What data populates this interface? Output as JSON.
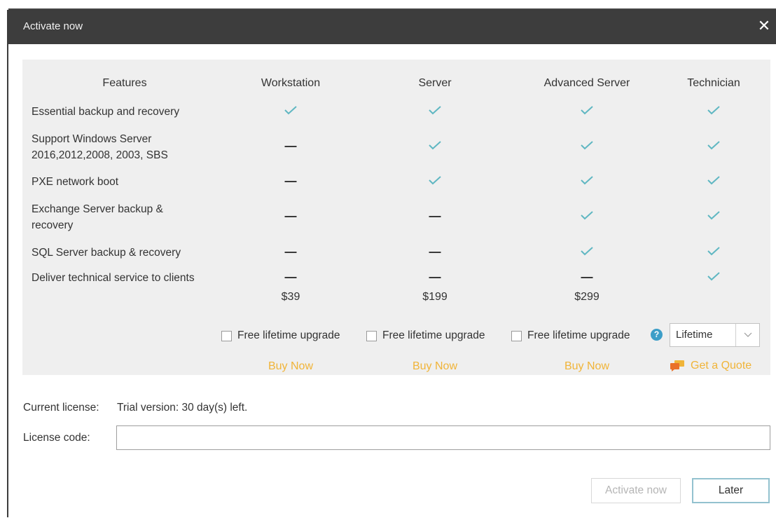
{
  "window": {
    "title": "Activate now",
    "close_label": "✕"
  },
  "colors": {
    "titlebar": "#3d3d3d",
    "panel": "#efefef",
    "check": "#5fb7c2",
    "accent_link": "#f0b438",
    "help": "#3c9ec8"
  },
  "table": {
    "headers": [
      "Features",
      "Workstation",
      "Server",
      "Advanced Server",
      "Technician"
    ],
    "features": [
      {
        "name": "Essential backup and recovery",
        "values": [
          true,
          true,
          true,
          true
        ]
      },
      {
        "name": "Support Windows Server 2016,2012,2008, 2003, SBS",
        "values": [
          false,
          true,
          true,
          true
        ]
      },
      {
        "name": "PXE network boot",
        "values": [
          false,
          true,
          true,
          true
        ]
      },
      {
        "name": "Exchange Server backup & recovery",
        "values": [
          false,
          false,
          true,
          true
        ]
      },
      {
        "name": "SQL Server backup & recovery",
        "values": [
          false,
          false,
          true,
          true
        ]
      },
      {
        "name": "Deliver technical service to clients",
        "values": [
          false,
          false,
          false,
          true
        ]
      }
    ],
    "prices": [
      "$39",
      "$199",
      "$299"
    ],
    "upgrade_label": "Free lifetime upgrade",
    "upgrade_checked": [
      false,
      false,
      false
    ],
    "license_type": {
      "selected": "Lifetime"
    },
    "buy_label": "Buy Now",
    "quote_label": "Get a Quote"
  },
  "license": {
    "current_label": "Current license:",
    "current_value": "Trial version: 30 day(s) left.",
    "code_label": "License code:",
    "code_value": ""
  },
  "buttons": {
    "activate": "Activate now",
    "later": "Later"
  }
}
